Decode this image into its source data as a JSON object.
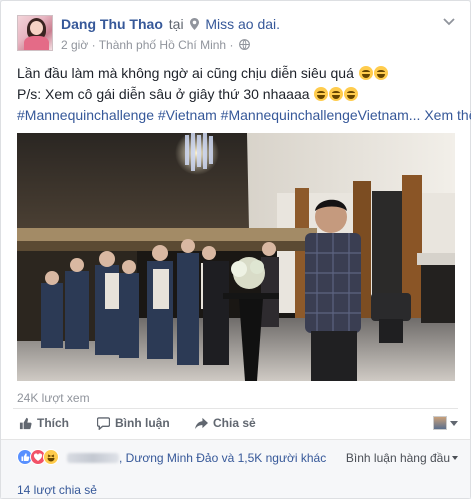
{
  "post": {
    "author": "Dang Thu Thao",
    "at_word": "tại",
    "location": "Miss ao dai.",
    "time": "2 giờ",
    "separator": "·",
    "city": "Thành phố Hồ Chí Minh",
    "separator2": "·",
    "privacy_icon": "globe-icon",
    "line1": "Lần đầu làm mà không ngờ ai cũng chịu diễn siêu quá",
    "line2": "P/s: Xem cô gái diễn sâu ở giây thứ 30 nhaaaa",
    "hashtags": "#Mannequinchallenge #Vietnam #MannequinchallengeVietnam...",
    "see_more": "Xem thêm",
    "emoji": "laughing-emoji"
  },
  "video": {
    "views": "24K lượt xem"
  },
  "actions": {
    "like": "Thích",
    "comment": "Bình luận",
    "share": "Chia sẻ"
  },
  "reactions": {
    "names_suffix": ", Dương Minh Đảo và 1,5K người khác",
    "sort_label": "Bình luận hàng đầu",
    "shares": "14 lượt chia sẻ"
  },
  "colors": {
    "link": "#365899",
    "like": "#5890ff",
    "love": "#f25268",
    "haha": "#ffcc4d"
  }
}
